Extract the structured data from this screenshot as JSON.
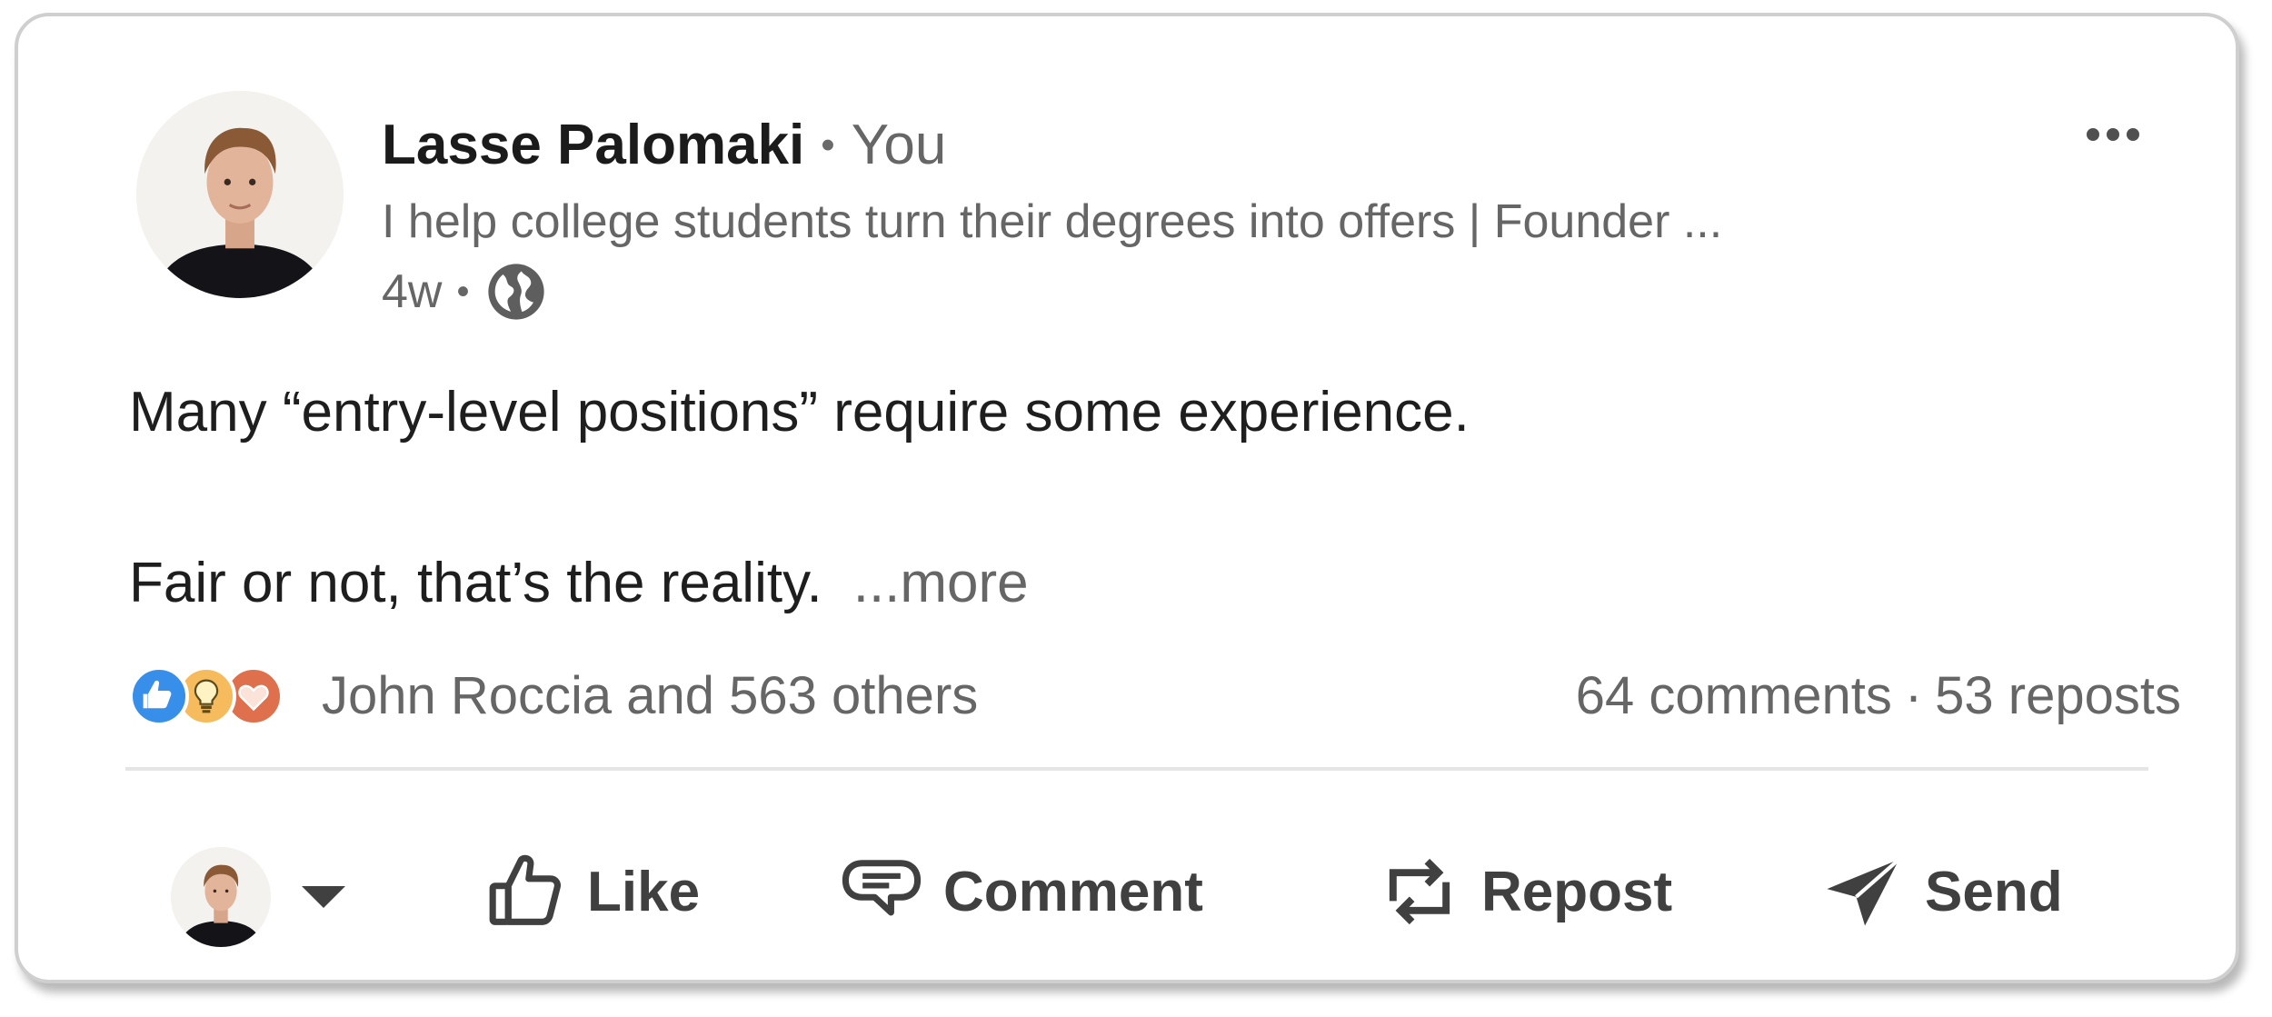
{
  "post": {
    "author": {
      "name": "Lasse Palomaki",
      "relation": "You",
      "headline": "I help college students turn their degrees into offers | Founder ...",
      "time": "4w",
      "visibility_icon": "globe-icon"
    },
    "body": {
      "line1": "Many “entry-level positions” require some experience.",
      "line2": "Fair or not, that’s the reality.",
      "see_more": "...more"
    },
    "reactions": {
      "icons": [
        "like-reaction-icon",
        "insightful-reaction-icon",
        "love-reaction-icon"
      ],
      "summary": "John Roccia and 563 others"
    },
    "social": {
      "comments": "64 comments",
      "separator": "·",
      "reposts": "53 reposts"
    }
  },
  "actions": {
    "like": "Like",
    "comment": "Comment",
    "repost": "Repost",
    "send": "Send"
  },
  "colors": {
    "like_blue": "#378fe9",
    "insightful_yellow": "#f5bb5c",
    "love_red": "#df704d",
    "secondary_text": "#666666",
    "action_text": "#404040"
  }
}
